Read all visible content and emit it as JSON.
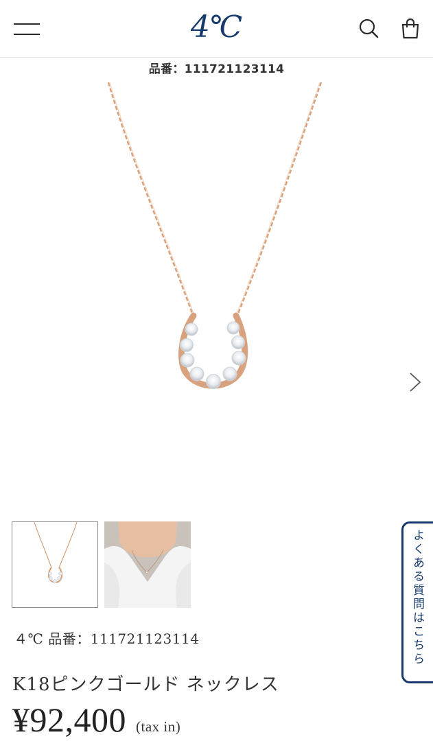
{
  "header": {
    "logo_text": "4℃",
    "icons": {
      "menu": "hamburger-menu-icon",
      "search": "search-icon",
      "bag": "shopping-bag-icon"
    },
    "accent_color": "#163a6b"
  },
  "product": {
    "sku_header": "品番：111721123114",
    "brand_sku": "４℃ 品番：111721123114",
    "name": "K18ピンクゴールド ネックレス",
    "price": "¥92,400",
    "tax_label": "(tax in)"
  },
  "gallery": {
    "thumbnails": [
      "horseshoe-necklace-thumbnail",
      "model-wearing-necklace-thumbnail"
    ],
    "selected_index": 0,
    "next_icon": "chevron-right-icon"
  },
  "faq": {
    "label": "よくある質問はこちら"
  }
}
